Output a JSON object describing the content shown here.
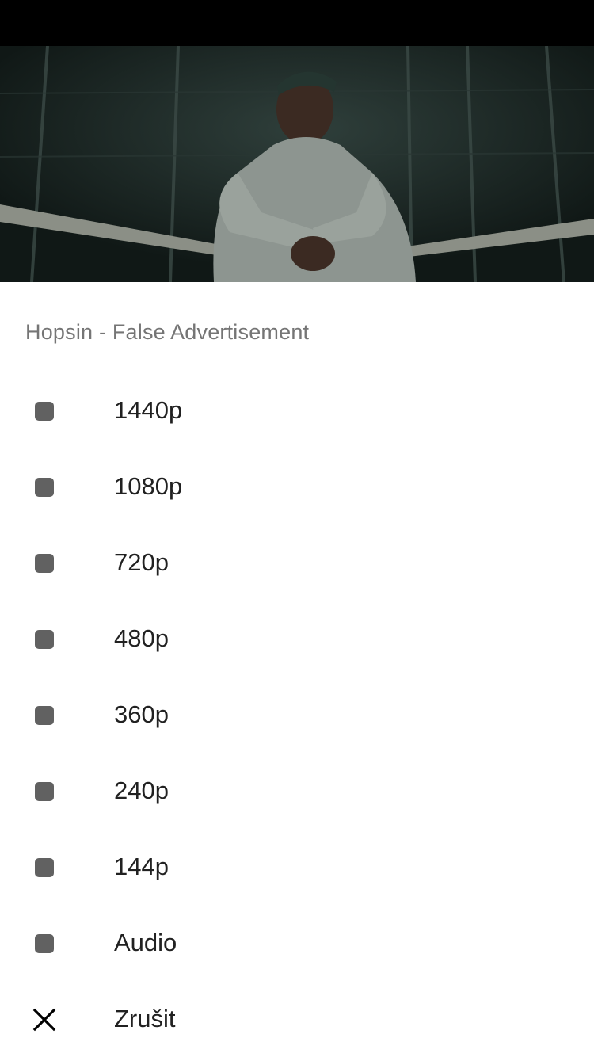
{
  "sheet": {
    "title": "Hopsin - False Advertisement",
    "options": [
      {
        "label": "1440p",
        "icon": "bullet-icon"
      },
      {
        "label": "1080p",
        "icon": "bullet-icon"
      },
      {
        "label": "720p",
        "icon": "bullet-icon"
      },
      {
        "label": "480p",
        "icon": "bullet-icon"
      },
      {
        "label": "360p",
        "icon": "bullet-icon"
      },
      {
        "label": "240p",
        "icon": "bullet-icon"
      },
      {
        "label": "144p",
        "icon": "bullet-icon"
      },
      {
        "label": "Audio",
        "icon": "bullet-icon"
      }
    ],
    "cancel": {
      "label": "Zrušit",
      "icon": "close-icon"
    }
  },
  "colors": {
    "status_bar": "#000000",
    "title": "#757575",
    "label": "#212121",
    "bullet": "#616161"
  }
}
